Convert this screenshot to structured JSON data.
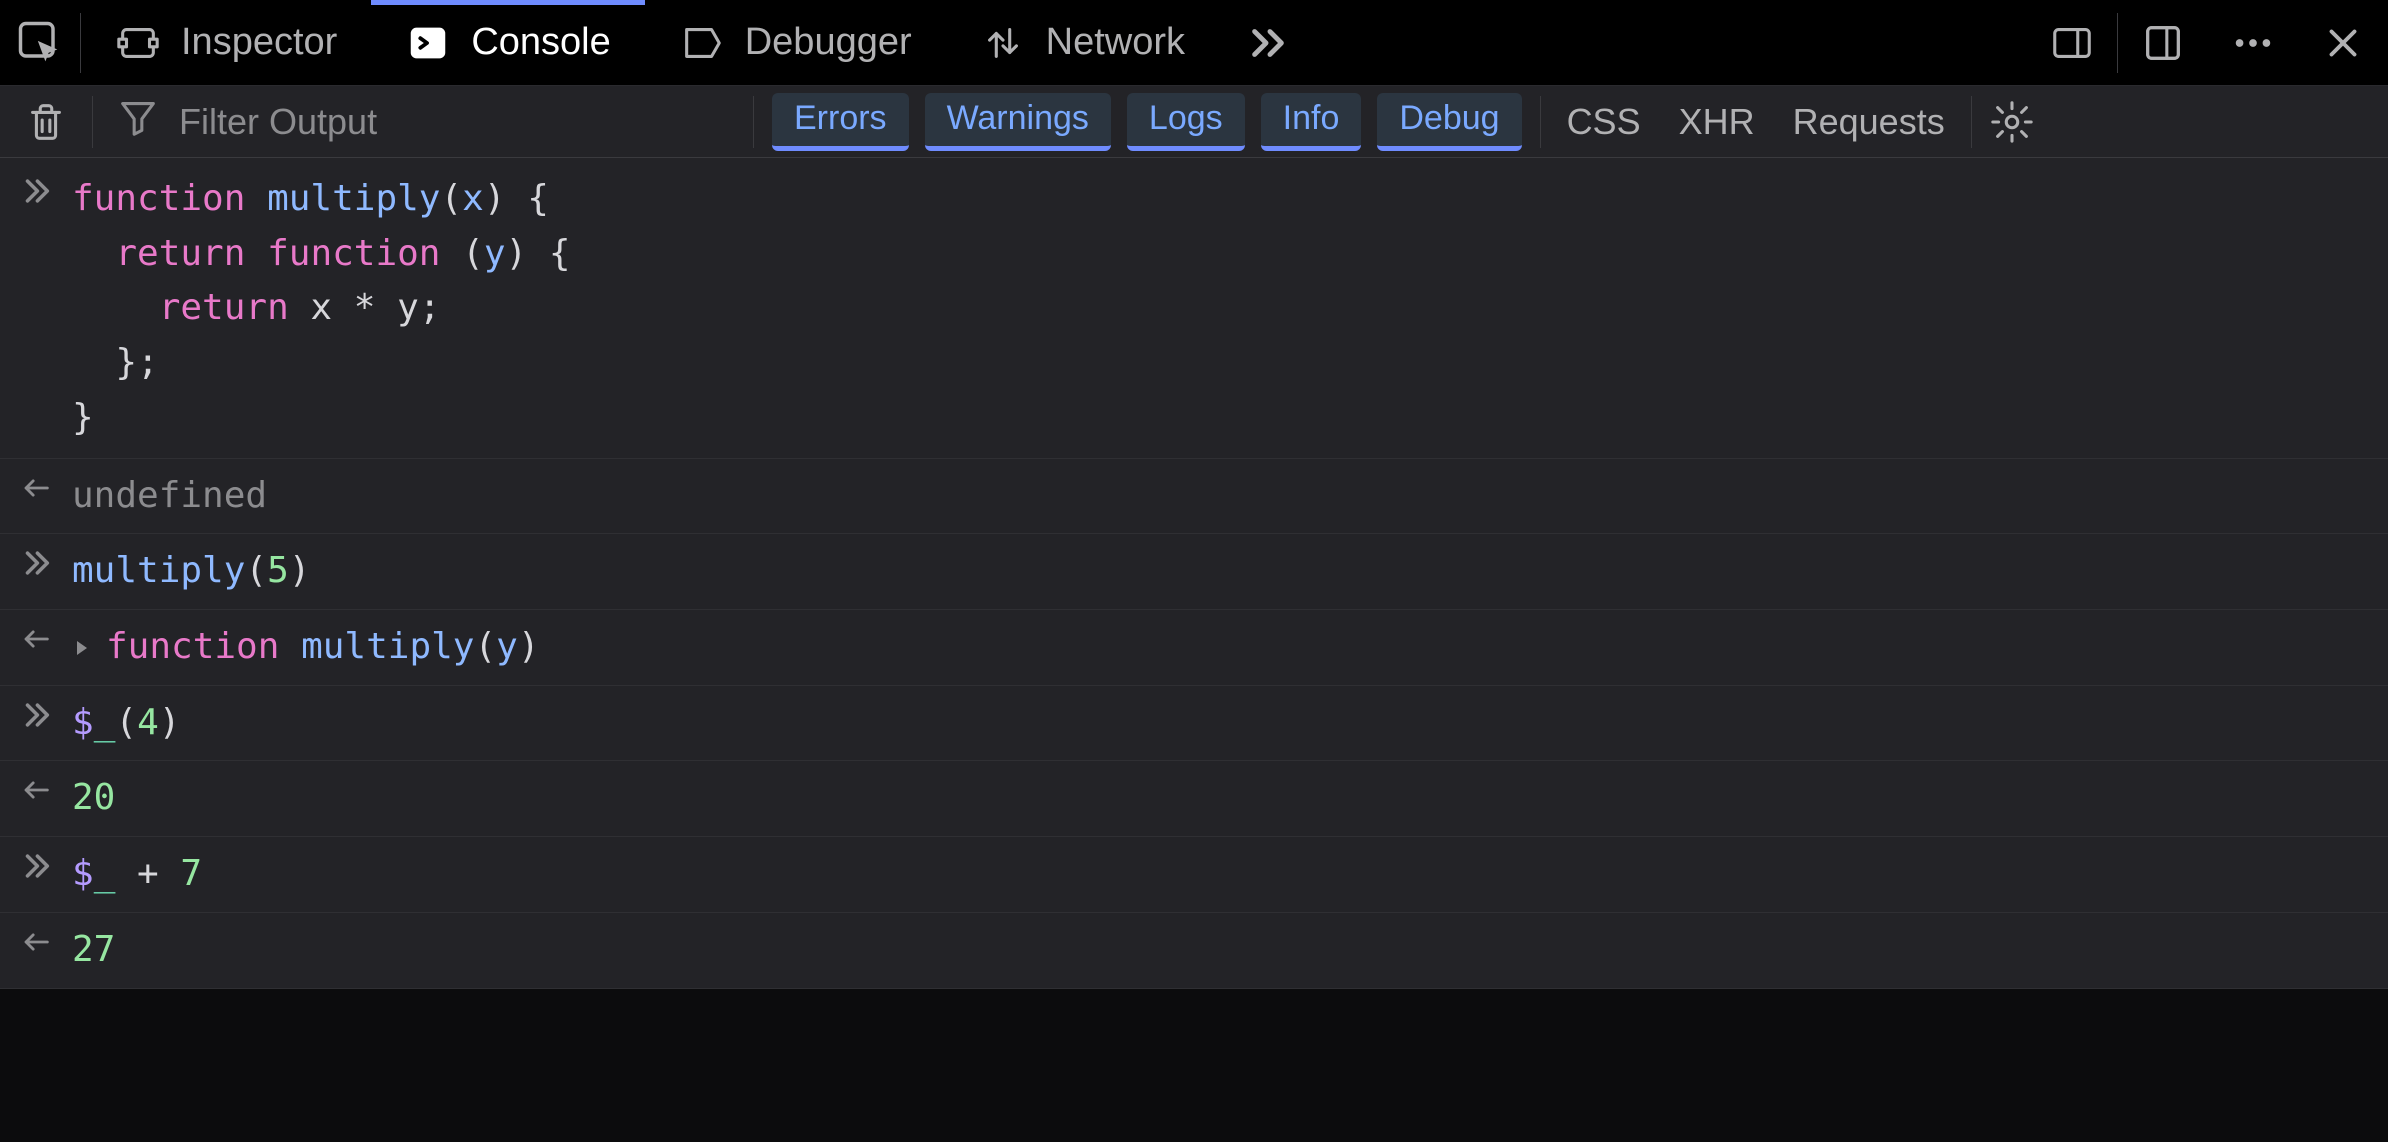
{
  "tabs": {
    "inspector": "Inspector",
    "console": "Console",
    "debugger": "Debugger",
    "network": "Network"
  },
  "filter": {
    "placeholder": "Filter Output",
    "pills": {
      "errors": "Errors",
      "warnings": "Warnings",
      "logs": "Logs",
      "info": "Info",
      "debug": "Debug"
    },
    "toggles": {
      "css": "CSS",
      "xhr": "XHR",
      "requests": "Requests"
    }
  },
  "console": {
    "entries": [
      {
        "kind": "input",
        "tokens": [
          {
            "t": "function",
            "c": "kw"
          },
          {
            "t": " ",
            "c": "punc"
          },
          {
            "t": "multiply",
            "c": "fn"
          },
          {
            "t": "(",
            "c": "punc"
          },
          {
            "t": "x",
            "c": "param"
          },
          {
            "t": ") {",
            "c": "punc"
          },
          {
            "t": "\n  ",
            "c": "punc"
          },
          {
            "t": "return",
            "c": "kw"
          },
          {
            "t": " ",
            "c": "punc"
          },
          {
            "t": "function",
            "c": "kw"
          },
          {
            "t": " (",
            "c": "punc"
          },
          {
            "t": "y",
            "c": "param"
          },
          {
            "t": ") {",
            "c": "punc"
          },
          {
            "t": "\n    ",
            "c": "punc"
          },
          {
            "t": "return",
            "c": "kw"
          },
          {
            "t": " x ",
            "c": "punc"
          },
          {
            "t": "*",
            "c": "op"
          },
          {
            "t": " y;",
            "c": "punc"
          },
          {
            "t": "\n  };",
            "c": "punc"
          },
          {
            "t": "\n}",
            "c": "punc"
          }
        ]
      },
      {
        "kind": "output",
        "tokens": [
          {
            "t": "undefined",
            "c": "undef"
          }
        ]
      },
      {
        "kind": "input",
        "tokens": [
          {
            "t": "multiply",
            "c": "fn"
          },
          {
            "t": "(",
            "c": "punc"
          },
          {
            "t": "5",
            "c": "num"
          },
          {
            "t": ")",
            "c": "punc"
          }
        ]
      },
      {
        "kind": "output",
        "expand": true,
        "tokens": [
          {
            "t": "function",
            "c": "kw"
          },
          {
            "t": " ",
            "c": "punc"
          },
          {
            "t": "multiply",
            "c": "fn"
          },
          {
            "t": "(",
            "c": "punc"
          },
          {
            "t": "y",
            "c": "param"
          },
          {
            "t": ")",
            "c": "punc"
          }
        ]
      },
      {
        "kind": "input",
        "tokens": [
          {
            "t": "$",
            "c": "dollar"
          },
          {
            "t": "_",
            "c": "under"
          },
          {
            "t": "(",
            "c": "punc"
          },
          {
            "t": "4",
            "c": "num"
          },
          {
            "t": ")",
            "c": "punc"
          }
        ]
      },
      {
        "kind": "output",
        "tokens": [
          {
            "t": "20",
            "c": "num"
          }
        ]
      },
      {
        "kind": "input",
        "tokens": [
          {
            "t": "$",
            "c": "dollar"
          },
          {
            "t": "_",
            "c": "under"
          },
          {
            "t": " + ",
            "c": "punc"
          },
          {
            "t": "7",
            "c": "num"
          }
        ]
      },
      {
        "kind": "output",
        "tokens": [
          {
            "t": "27",
            "c": "num"
          }
        ]
      }
    ]
  }
}
